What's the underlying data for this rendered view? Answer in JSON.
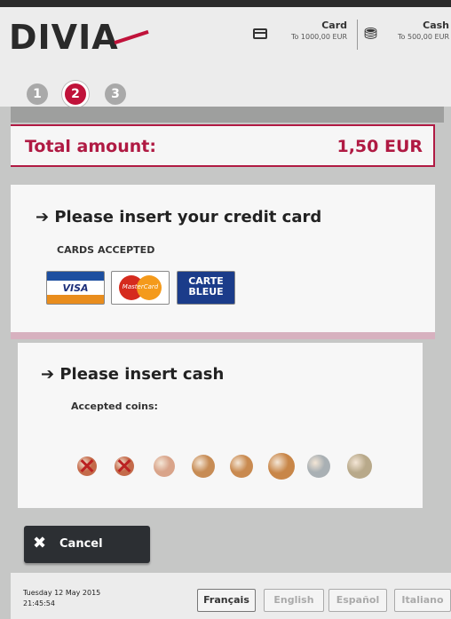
{
  "header": {
    "logo": "DIVIA",
    "card": {
      "label": "Card",
      "limit": "To 1000,00 EUR",
      "icon": "credit-card-icon"
    },
    "cash": {
      "label": "Cash",
      "limit": "To 500,00 EUR",
      "icon": "coins-icon"
    },
    "steps": [
      "1",
      "2",
      "3"
    ],
    "active_step": "2"
  },
  "total": {
    "label": "Total amount:",
    "amount": "1,50 EUR"
  },
  "card_panel": {
    "title": "➔ Please insert your credit card",
    "accepted_label": "CARDS ACCEPTED",
    "cards": [
      {
        "name": "VISA",
        "text": "VISA"
      },
      {
        "name": "MasterCard",
        "text": "MasterCard"
      },
      {
        "name": "CARTE BLEUE",
        "text": "CARTE BLEUE"
      }
    ]
  },
  "cash_panel": {
    "title": "➔ Please insert cash",
    "accepted_label": "Accepted coins:",
    "coins": [
      {
        "accepted": false,
        "color": "#c46a4a"
      },
      {
        "accepted": false,
        "color": "#c46a4a"
      },
      {
        "accepted": true,
        "color": "#d9a48a"
      },
      {
        "accepted": true,
        "color": "#c78c55"
      },
      {
        "accepted": true,
        "color": "#c98a50"
      },
      {
        "accepted": true,
        "color": "#c88648"
      },
      {
        "accepted": true,
        "color": "#a9b0b4"
      },
      {
        "accepted": true,
        "color": "#b8a98a"
      }
    ]
  },
  "cancel_label": "Cancel",
  "datetime": {
    "date": "Tuesday 12 May 2015",
    "time": "21:45:54"
  },
  "languages": [
    "Français",
    "English",
    "Español",
    "Italiano"
  ],
  "active_language": "Français",
  "colors": {
    "accent": "#b01a43",
    "button": "#2c2f33"
  }
}
